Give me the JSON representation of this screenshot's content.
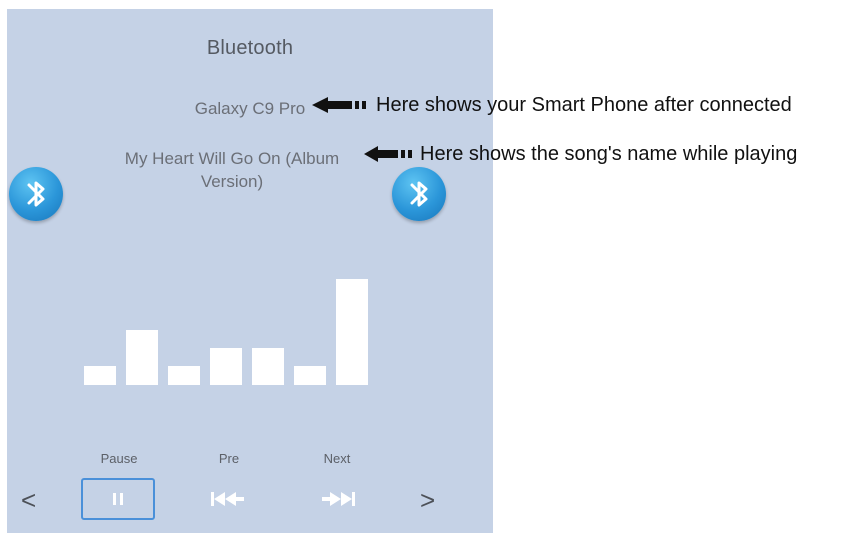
{
  "screen": {
    "title": "Bluetooth",
    "device_name": "Galaxy C9 Pro",
    "song_name": "My Heart Will Go On (Album Version)",
    "bluetooth_icon_left": "bluetooth-icon",
    "bluetooth_icon_right": "bluetooth-icon",
    "equalizer_levels": [
      0.18,
      0.52,
      0.18,
      0.35,
      0.35,
      0.18,
      1.0
    ],
    "controls": {
      "pause_label": "Pause",
      "prev_label": "Pre",
      "next_label": "Next"
    },
    "nav": {
      "prev_arrow": "<",
      "next_arrow": ">"
    }
  },
  "annotations": {
    "phone_note": "Here shows your Smart Phone after connected",
    "song_note": "Here shows the song's name while playing"
  },
  "colors": {
    "screen_bg": "#c5d2e6",
    "accent": "#4a90d9",
    "bluetooth_blue": "#2b96d9"
  }
}
